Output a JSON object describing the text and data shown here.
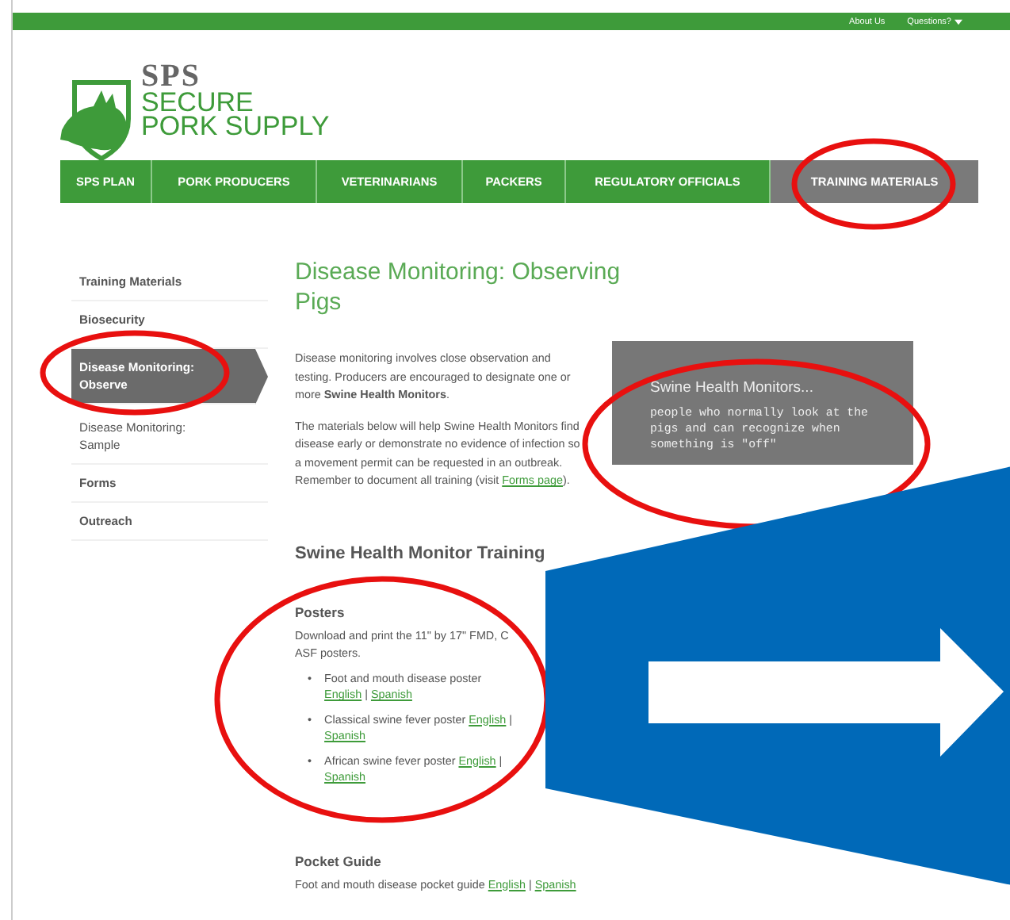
{
  "top_links": [
    {
      "label": "About Us",
      "dropdown": false
    },
    {
      "label": "Questions?",
      "dropdown": true
    }
  ],
  "logo": {
    "abbr": "SPS",
    "line1": "SECURE",
    "line2": "PORK SUPPLY"
  },
  "nav": [
    {
      "label": "SPS PLAN",
      "selected": false
    },
    {
      "label": "PORK PRODUCERS",
      "selected": false
    },
    {
      "label": "VETERINARIANS",
      "selected": false
    },
    {
      "label": "PACKERS",
      "selected": false
    },
    {
      "label": "REGULATORY OFFICIALS",
      "selected": false
    },
    {
      "label": "TRAINING MATERIALS",
      "selected": true
    }
  ],
  "sidebar": [
    {
      "label": "Training Materials",
      "selected": false
    },
    {
      "label": "Biosecurity",
      "selected": false
    },
    {
      "label": "Disease Monitoring: Observe",
      "selected": true
    },
    {
      "label": "Disease Monitoring: Sample",
      "selected": false
    },
    {
      "label": "Forms",
      "selected": false
    },
    {
      "label": "Outreach",
      "selected": false
    }
  ],
  "title": "Disease Monitoring: Observing Pigs",
  "intro": "Disease monitoring involves close observation and testing. Producers are encouraged to designate one or more **Swine Health Monitors**.",
  "materials": {
    "before": "The materials below will help Swine Health Monitors find disease early or demonstrate no evidence of infection so a movement permit can be requested in an outbreak. Remember to document all training (visit ",
    "link": "Forms page",
    "after": ")."
  },
  "callout": {
    "title": "Swine Health Monitors...",
    "body": "people who normally look at the pigs and can recognize when something is \"off\""
  },
  "section_title": "Swine Health Monitor Training",
  "posters": {
    "title": "Posters",
    "lines": [
      "Download and print the 11\" by 17\" FMD, C",
      "ASF posters."
    ],
    "items": [
      {
        "text": "Foot and mouth disease poster",
        "links": [
          "English",
          "Spanish"
        ]
      },
      {
        "text": "Classical swine fever poster",
        "links": [
          "English",
          "Spanish"
        ]
      },
      {
        "text": "African swine fever poster",
        "links": [
          "English",
          "Spanish"
        ]
      }
    ]
  },
  "bullet": "•",
  "pocket_guide": {
    "title": "Pocket Guide",
    "text": "Foot and mouth disease pocket guide",
    "links": [
      "English",
      "Spanish"
    ]
  },
  "link_separator": "|",
  "annotations": [
    {
      "kind": "circle"
    },
    {
      "kind": "circle"
    },
    {
      "kind": "circle"
    },
    {
      "kind": "circle"
    },
    {
      "kind": "arrow"
    }
  ]
}
